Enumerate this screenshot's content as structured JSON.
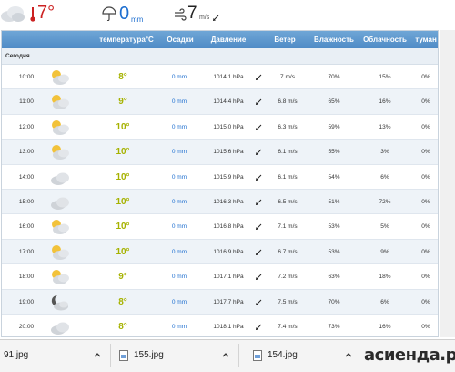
{
  "summary": {
    "temp": "7°",
    "precip": "0",
    "precip_unit": "mm",
    "wind": "7",
    "wind_unit": "m/s"
  },
  "table": {
    "headers": {
      "temp": "температура°C",
      "precip": "Осадки",
      "pressure": "Давление",
      "wind": "Ветер",
      "humidity": "Влажность",
      "cloudiness": "Облачность",
      "fog": "туман"
    },
    "section_label": "Сегодня",
    "rows": [
      {
        "time": "10:00",
        "icon": "partly-cloudy-icon",
        "temp": "8°",
        "precip": "0 mm",
        "pressure": "1014.1 hPa",
        "wind": "7 m/s",
        "humidity": "70%",
        "cloudiness": "15%",
        "fog": "0%"
      },
      {
        "time": "11:00",
        "icon": "partly-cloudy-icon",
        "temp": "9°",
        "precip": "0 mm",
        "pressure": "1014.4 hPa",
        "wind": "6.8 m/s",
        "humidity": "65%",
        "cloudiness": "16%",
        "fog": "0%"
      },
      {
        "time": "12:00",
        "icon": "partly-cloudy-icon",
        "temp": "10°",
        "precip": "0 mm",
        "pressure": "1015.0 hPa",
        "wind": "6.3 m/s",
        "humidity": "59%",
        "cloudiness": "13%",
        "fog": "0%"
      },
      {
        "time": "13:00",
        "icon": "partly-cloudy-icon",
        "temp": "10°",
        "precip": "0 mm",
        "pressure": "1015.6 hPa",
        "wind": "6.1 m/s",
        "humidity": "55%",
        "cloudiness": "3%",
        "fog": "0%"
      },
      {
        "time": "14:00",
        "icon": "cloud-icon",
        "temp": "10°",
        "precip": "0 mm",
        "pressure": "1015.9 hPa",
        "wind": "6.1 m/s",
        "humidity": "54%",
        "cloudiness": "6%",
        "fog": "0%"
      },
      {
        "time": "15:00",
        "icon": "cloud-icon",
        "temp": "10°",
        "precip": "0 mm",
        "pressure": "1016.3 hPa",
        "wind": "6.5 m/s",
        "humidity": "51%",
        "cloudiness": "72%",
        "fog": "0%"
      },
      {
        "time": "16:00",
        "icon": "partly-cloudy-icon",
        "temp": "10°",
        "precip": "0 mm",
        "pressure": "1016.8 hPa",
        "wind": "7.1 m/s",
        "humidity": "53%",
        "cloudiness": "5%",
        "fog": "0%"
      },
      {
        "time": "17:00",
        "icon": "partly-cloudy-icon",
        "temp": "10°",
        "precip": "0 mm",
        "pressure": "1016.9 hPa",
        "wind": "6.7 m/s",
        "humidity": "53%",
        "cloudiness": "9%",
        "fog": "0%"
      },
      {
        "time": "18:00",
        "icon": "partly-cloudy-icon",
        "temp": "9°",
        "precip": "0 mm",
        "pressure": "1017.1 hPa",
        "wind": "7.2 m/s",
        "humidity": "63%",
        "cloudiness": "18%",
        "fog": "0%"
      },
      {
        "time": "19:00",
        "icon": "moon-cloud-icon",
        "temp": "8°",
        "precip": "0 mm",
        "pressure": "1017.7 hPa",
        "wind": "7.5 m/s",
        "humidity": "70%",
        "cloudiness": "6%",
        "fog": "0%"
      },
      {
        "time": "20:00",
        "icon": "cloud-icon",
        "temp": "8°",
        "precip": "0 mm",
        "pressure": "1018.1 hPa",
        "wind": "7.4 m/s",
        "humidity": "73%",
        "cloudiness": "16%",
        "fog": "0%"
      }
    ]
  },
  "downloads": [
    {
      "name": "91.jpg"
    },
    {
      "name": "155.jpg"
    },
    {
      "name": "154.jpg"
    }
  ],
  "watermark": "асиенда.ру",
  "colors": {
    "header": "#5a95cc",
    "temp": "#a6b200",
    "precip": "#1e6fd0",
    "summary_temp": "#cc2222"
  }
}
